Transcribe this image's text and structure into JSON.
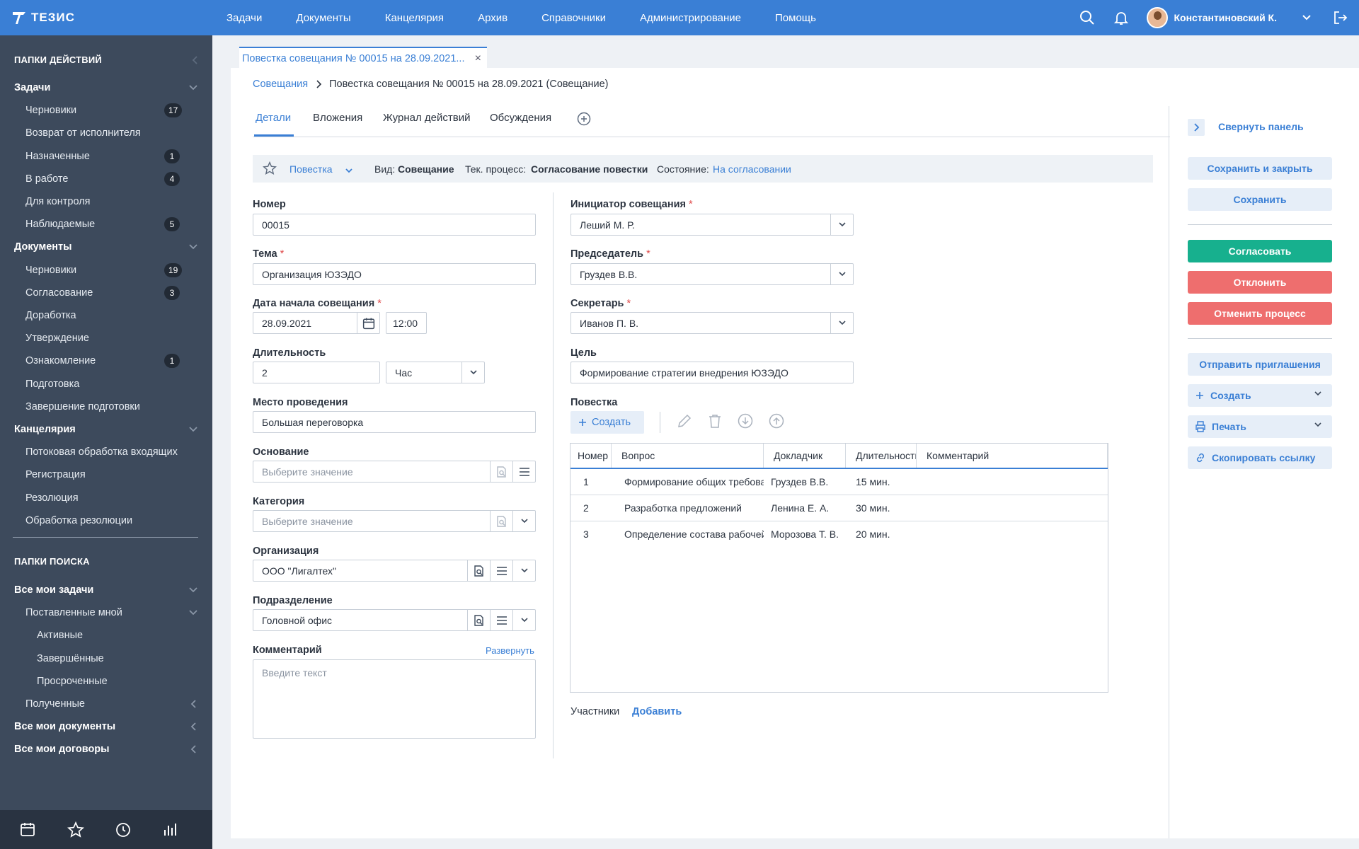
{
  "app": {
    "logo_text": "ТЕЗИС"
  },
  "topnav": {
    "items": [
      "Задачи",
      "Документы",
      "Канцелярия",
      "Архив",
      "Справочники",
      "Администрирование",
      "Помощь"
    ]
  },
  "user": {
    "name": "Константиновский К."
  },
  "sidebar": {
    "action_folders_title": "ПАПКИ ДЕЙСТВИЙ",
    "items": [
      {
        "label": "Задачи",
        "level": 0
      },
      {
        "label": "Черновики",
        "level": 1,
        "badge": "17"
      },
      {
        "label": "Возврат от исполнителя",
        "level": 1
      },
      {
        "label": "Назначенные",
        "level": 1,
        "badge": "1"
      },
      {
        "label": "В работе",
        "level": 1,
        "badge": "4"
      },
      {
        "label": "Для контроля",
        "level": 1
      },
      {
        "label": "Наблюдаемые",
        "level": 1,
        "badge": "5"
      },
      {
        "label": "Документы",
        "level": 0
      },
      {
        "label": "Черновики",
        "level": 1,
        "badge": "19"
      },
      {
        "label": "Согласование",
        "level": 1,
        "badge": "3"
      },
      {
        "label": "Доработка",
        "level": 1
      },
      {
        "label": "Утверждение",
        "level": 1
      },
      {
        "label": "Ознакомление",
        "level": 1,
        "badge": "1"
      },
      {
        "label": "Подготовка",
        "level": 1
      },
      {
        "label": "Завершение подготовки",
        "level": 1
      },
      {
        "label": "Канцелярия",
        "level": 0
      },
      {
        "label": "Потоковая обработка входящих",
        "level": 1
      },
      {
        "label": "Регистрация",
        "level": 1
      },
      {
        "label": "Резолюция",
        "level": 1
      },
      {
        "label": "Обработка резолюции",
        "level": 1
      }
    ],
    "search_folders_title": "ПАПКИ ПОИСКА",
    "search_items": [
      {
        "label": "Все мои задачи",
        "level": 0
      },
      {
        "label": "Поставленные мной",
        "level": 1
      },
      {
        "label": "Активные",
        "level": 2
      },
      {
        "label": "Завершённые",
        "level": 2
      },
      {
        "label": "Просроченные",
        "level": 2
      },
      {
        "label": "Полученные",
        "level": 1
      },
      {
        "label": "Все мои документы",
        "level": 0
      },
      {
        "label": "Все мои договоры",
        "level": 0
      }
    ]
  },
  "doc_tab": {
    "title": "Повестка совещания № 00015 на 28.09.2021...",
    "close": "×"
  },
  "breadcrumb": {
    "parent": "Совещания",
    "current": "Повестка совещания № 00015 на 28.09.2021 (Совещание)"
  },
  "tabs": [
    "Детали",
    "Вложения",
    "Журнал действий",
    "Обсуждения"
  ],
  "infobar": {
    "doc_type": "Повестка",
    "kind_label": "Вид:",
    "kind_value": "Совещание",
    "process_label": "Тек. процесс:",
    "process_value": "Согласование повестки",
    "state_label": "Состояние:",
    "state_value": "На согласовании"
  },
  "form": {
    "number_label": "Номер",
    "number_value": "00015",
    "topic_label": "Тема",
    "topic_value": "Организация ЮЗЭДО",
    "start_date_label": "Дата начала совещания",
    "start_date_value": "28.09.2021",
    "start_time_value": "12:00",
    "duration_label": "Длительность",
    "duration_value": "2",
    "duration_unit": "Час",
    "place_label": "Место проведения",
    "place_value": "Большая переговорка",
    "basis_label": "Основание",
    "basis_placeholder": "Выберите значение",
    "category_label": "Категория",
    "category_placeholder": "Выберите значение",
    "org_label": "Организация",
    "org_value": "ООО \"Лигалтех\"",
    "dept_label": "Подразделение",
    "dept_value": "Головной офис",
    "comment_label": "Комментарий",
    "comment_expand": "Развернуть",
    "comment_placeholder": "Введите текст",
    "initiator_label": "Инициатор совещания",
    "initiator_value": "Леший М. Р.",
    "chair_label": "Председатель",
    "chair_value": "Груздев В.В.",
    "secretary_label": "Секретарь",
    "secretary_value": "Иванов П. В.",
    "goal_label": "Цель",
    "goal_value": "Формирование стратегии внедрения ЮЗЭДО",
    "agenda_label": "Повестка",
    "agenda_create": "Создать",
    "participants_label": "Участники",
    "participants_add": "Добавить"
  },
  "agenda_grid": {
    "columns": [
      "Номер",
      "Вопрос",
      "Докладчик",
      "Длительность",
      "Комментарий"
    ],
    "rows": [
      {
        "num": "1",
        "question": "Формирование общих требований",
        "speaker": "Груздев В.В.",
        "duration": "15 мин.",
        "comment": ""
      },
      {
        "num": "2",
        "question": "Разработка предложений",
        "speaker": "Ленина Е. А.",
        "duration": "30 мин.",
        "comment": ""
      },
      {
        "num": "3",
        "question": "Определение состава рабочей группы",
        "speaker": "Морозова Т. В.",
        "duration": "20 мин.",
        "comment": ""
      }
    ]
  },
  "right_panel": {
    "collapse": "Свернуть панель",
    "save_close": "Сохранить и закрыть",
    "save": "Сохранить",
    "approve": "Согласовать",
    "reject": "Отклонить",
    "cancel_process": "Отменить процесс",
    "send_invites": "Отправить приглашения",
    "create": "Создать",
    "print": "Печать",
    "copy_link": "Скопировать ссылку"
  },
  "colors": {
    "accent": "#3a7fd5",
    "sidebar": "#3d4a5c",
    "approve": "#17b08e",
    "reject": "#ee6e6e"
  }
}
